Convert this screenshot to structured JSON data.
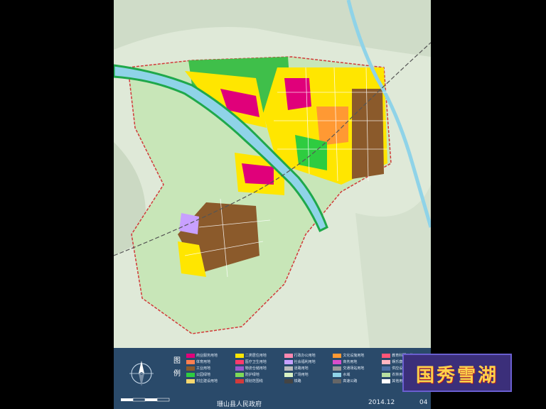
{
  "legend": {
    "title": "图例",
    "items": [
      {
        "label": "商业服务用地",
        "color": "#e0007a"
      },
      {
        "label": "二类居住用地",
        "color": "#ffe600"
      },
      {
        "label": "行政办公用地",
        "color": "#ff88b0"
      },
      {
        "label": "文化设施用地",
        "color": "#ff9933"
      },
      {
        "label": "教育科研用地",
        "color": "#ff5577"
      },
      {
        "label": "体育用地",
        "color": "#ff7f50"
      },
      {
        "label": "医疗卫生用地",
        "color": "#ff3b6b"
      },
      {
        "label": "社会福利用地",
        "color": "#c8a0ff"
      },
      {
        "label": "商务用地",
        "color": "#d94dcc"
      },
      {
        "label": "娱乐康体用地",
        "color": "#ffb6c1"
      },
      {
        "label": "工业用地",
        "color": "#8b5a2b"
      },
      {
        "label": "物流仓储用地",
        "color": "#9b59d0"
      },
      {
        "label": "道路用地",
        "color": "#bbbbbb"
      },
      {
        "label": "交通场站用地",
        "color": "#999999"
      },
      {
        "label": "供应设施用地",
        "color": "#4a6fa5"
      },
      {
        "label": "公园绿地",
        "color": "#2ecc40"
      },
      {
        "label": "防护绿地",
        "color": "#7ed957"
      },
      {
        "label": "广场用地",
        "color": "#d9f2c4"
      },
      {
        "label": "水域",
        "color": "#8fd3e8"
      },
      {
        "label": "农林用地",
        "color": "#b8e0a0"
      },
      {
        "label": "村庄建设用地",
        "color": "#f5d76e"
      },
      {
        "label": "规划范围线",
        "color": "#d23a3a"
      },
      {
        "label": "铁路",
        "color": "#444444"
      },
      {
        "label": "高速公路",
        "color": "#666666"
      },
      {
        "label": "其他用地",
        "color": "#ffffff"
      }
    ]
  },
  "footer": {
    "issuer": "珊山县人民政府",
    "date": "2014.12",
    "page": "04"
  },
  "stamp": {
    "text": "国秀雪湖"
  },
  "colors": {
    "residential": "#ffe600",
    "commercial": "#e0007a",
    "industrial": "#8b5a2b",
    "park": "#2ecc40",
    "river": "#8fd3e8",
    "boundary": "#d23a3a",
    "legend_bg": "#2a4a6a"
  }
}
